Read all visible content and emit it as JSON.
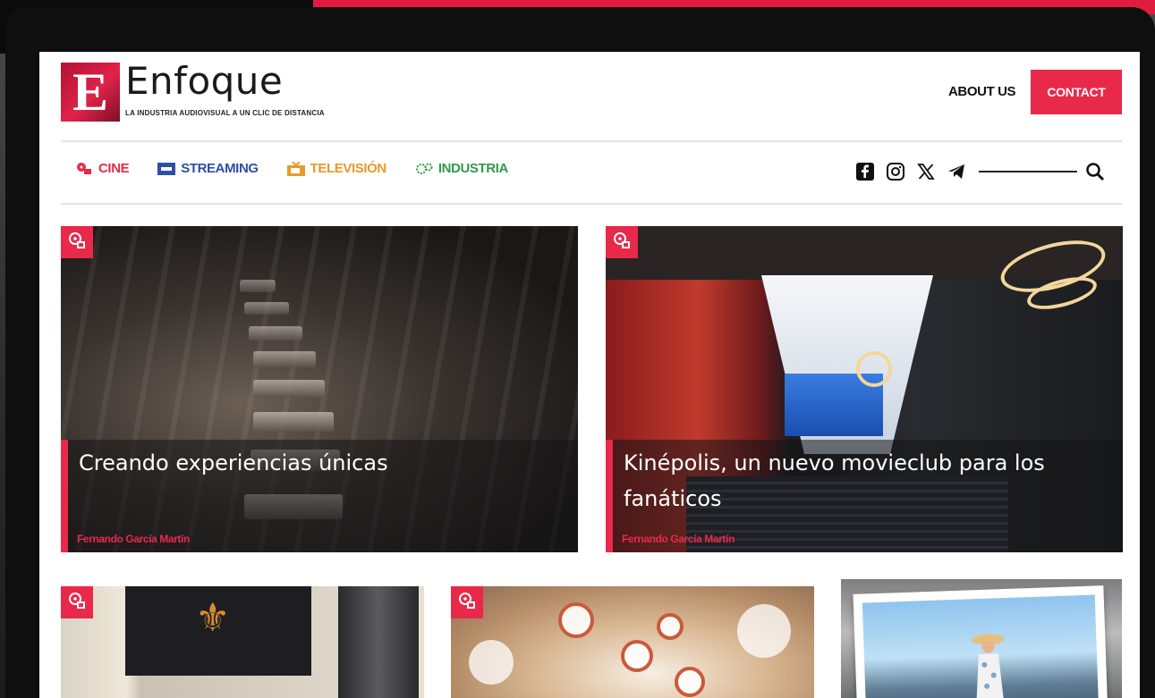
{
  "header": {
    "logo_letter": "E",
    "brand_name": "Enfoque",
    "tagline": "LA INDUSTRIA AUDIOVISUAL A UN CLIC DE DISTANCIA",
    "about_label": "ABOUT US",
    "contact_label": "CONTACT"
  },
  "nav": {
    "items": [
      {
        "label": "CINE",
        "icon": "film-reel-icon",
        "color": "#e8294a"
      },
      {
        "label": "STREAMING",
        "icon": "tv-streaming-icon",
        "color": "#2d4fa3"
      },
      {
        "label": "TELEVISIÓN",
        "icon": "television-icon",
        "color": "#e89a2a"
      },
      {
        "label": "INDUSTRIA",
        "icon": "gears-icon",
        "color": "#2f9a4a"
      }
    ]
  },
  "social": {
    "icons": [
      "facebook-icon",
      "instagram-icon",
      "x-icon",
      "telegram-icon"
    ],
    "search_icon": "search-icon"
  },
  "articles": {
    "featured": [
      {
        "title": "Creando experiencias únicas",
        "author": "Fernando García Martín",
        "category_icon": "film-reel-icon"
      },
      {
        "title": "Kinépolis, un nuevo movieclub para los fanáticos",
        "author": "Fernando García Martín",
        "category_icon": "film-reel-icon"
      }
    ]
  },
  "colors": {
    "accent": "#e8294a",
    "text_dark": "#111111"
  }
}
